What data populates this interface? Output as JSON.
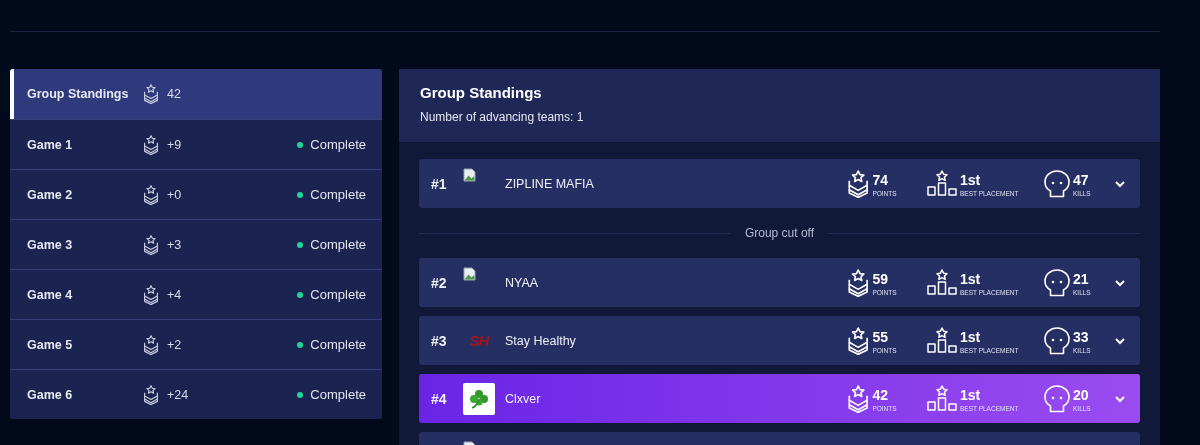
{
  "sidebar": {
    "items": [
      {
        "label": "Group Standings",
        "points": "42",
        "selected": true
      },
      {
        "label": "Game 1",
        "points": "+9",
        "status": "Complete",
        "color": "#1ed69a",
        "selected": false
      },
      {
        "label": "Game 2",
        "points": "+0",
        "status": "Complete",
        "color": "#1ed69a",
        "selected": false
      },
      {
        "label": "Game 3",
        "points": "+3",
        "status": "Complete",
        "color": "#1ed69a",
        "selected": false
      },
      {
        "label": "Game 4",
        "points": "+4",
        "status": "Complete",
        "color": "#1ed69a",
        "selected": false
      },
      {
        "label": "Game 5",
        "points": "+2",
        "status": "Complete",
        "color": "#1ed69a",
        "selected": false
      },
      {
        "label": "Game 6",
        "points": "+24",
        "status": "Complete",
        "color": "#1ed69a",
        "selected": false
      }
    ]
  },
  "standings": {
    "title": "Group Standings",
    "subtitle": "Number of advancing teams: 1",
    "rows": [
      {
        "kind": "team",
        "rank": "#1",
        "logo": {
          "kind": "broken"
        },
        "name": "ZIPLINE MAFIA",
        "points": "74",
        "points_label": "POINTS",
        "placement": "1st",
        "placement_label": "BEST PLACEMENT",
        "kills": "47",
        "kills_label": "KILLS",
        "selected": false
      },
      {
        "kind": "cutoff",
        "label": "Group cut off"
      },
      {
        "kind": "team",
        "rank": "#2",
        "logo": {
          "kind": "broken"
        },
        "name": "NYAA",
        "points": "59",
        "points_label": "POINTS",
        "placement": "1st",
        "placement_label": "BEST PLACEMENT",
        "kills": "21",
        "kills_label": "KILLS",
        "selected": false
      },
      {
        "kind": "team",
        "rank": "#3",
        "logo": {
          "kind": "text",
          "text": "SH"
        },
        "name": "Stay Healthy",
        "points": "55",
        "points_label": "POINTS",
        "placement": "1st",
        "placement_label": "BEST PLACEMENT",
        "kills": "33",
        "kills_label": "KILLS",
        "selected": false
      },
      {
        "kind": "team",
        "rank": "#4",
        "logo": {
          "kind": "clover"
        },
        "name": "Clxver",
        "points": "42",
        "points_label": "POINTS",
        "placement": "1st",
        "placement_label": "BEST PLACEMENT",
        "kills": "20",
        "kills_label": "KILLS",
        "selected": true
      },
      {
        "kind": "team",
        "logo": {
          "kind": "broken"
        },
        "selected": false
      }
    ]
  }
}
